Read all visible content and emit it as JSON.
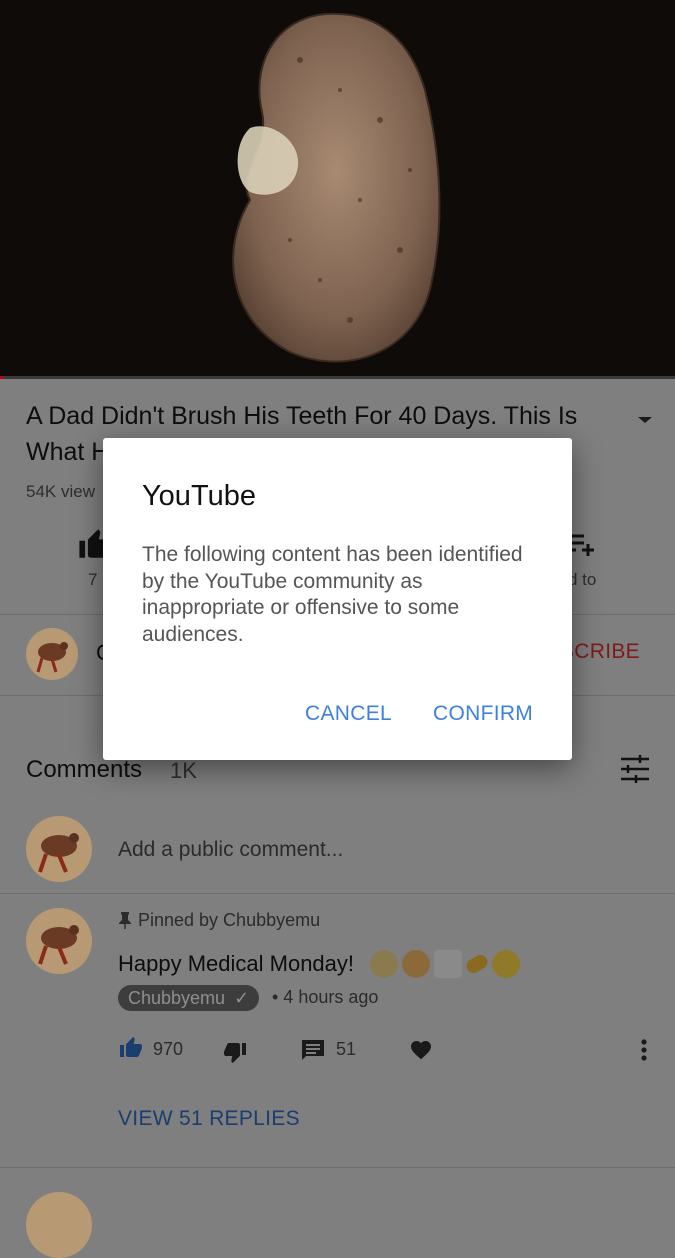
{
  "video": {
    "title": "A Dad Didn't Brush His Teeth For 40 Days. This Is What H",
    "views": "54K view",
    "like_count": "7",
    "save_label": "d to",
    "progress": 0.005
  },
  "channel": {
    "name_partial": "C",
    "subscribe_label": "SCRIBE"
  },
  "comments": {
    "title": "Comments",
    "count": "1K",
    "add_placeholder": "Add a public comment...",
    "pinned": {
      "pinned_label": "Pinned by Chubbyemu",
      "text": "Happy Medical Monday!",
      "emoji_icons": [
        "male-health-worker-emoji",
        "female-health-worker-emoji",
        "ambulance-emoji",
        "pill-emoji",
        "face-with-monocle-emoji"
      ],
      "author": "Chubbyemu",
      "time": "• 4 hours ago",
      "likes": "970",
      "replies": "51",
      "view_replies": "VIEW 51 REPLIES"
    }
  },
  "dialog": {
    "title": "YouTube",
    "body": "The following content has been identified by the YouTube community as inappropriate or offensive to some audiences.",
    "cancel": "CANCEL",
    "confirm": "CONFIRM"
  },
  "colors": {
    "accent": "#3e7fe0",
    "overlay": "#7f7f7f",
    "progress": "#cc0000"
  }
}
